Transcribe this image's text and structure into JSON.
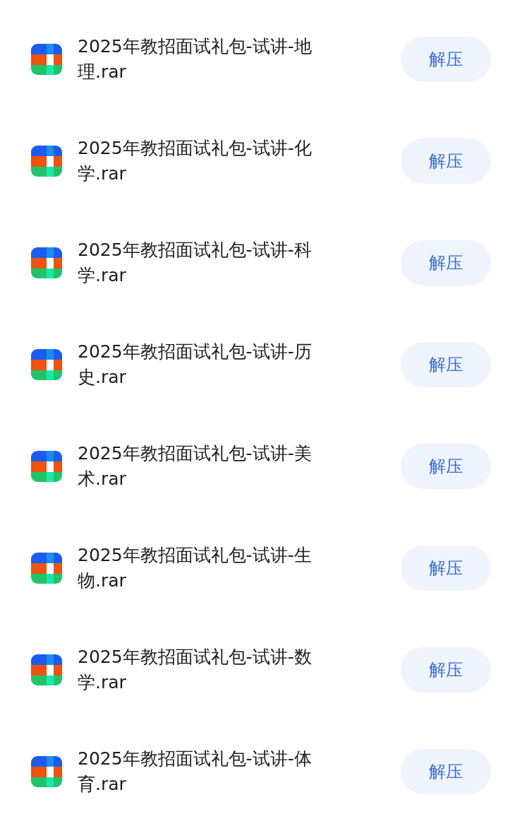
{
  "files": [
    {
      "name": "2025年教招面试礼包-试讲-地理.rar",
      "action": "解压"
    },
    {
      "name": "2025年教招面试礼包-试讲-化学.rar",
      "action": "解压"
    },
    {
      "name": "2025年教招面试礼包-试讲-科学.rar",
      "action": "解压"
    },
    {
      "name": "2025年教招面试礼包-试讲-历史.rar",
      "action": "解压"
    },
    {
      "name": "2025年教招面试礼包-试讲-美术.rar",
      "action": "解压"
    },
    {
      "name": "2025年教招面试礼包-试讲-生物.rar",
      "action": "解压"
    },
    {
      "name": "2025年教招面试礼包-试讲-数学.rar",
      "action": "解压"
    },
    {
      "name": "2025年教招面试礼包-试讲-体育.rar",
      "action": "解压"
    }
  ]
}
